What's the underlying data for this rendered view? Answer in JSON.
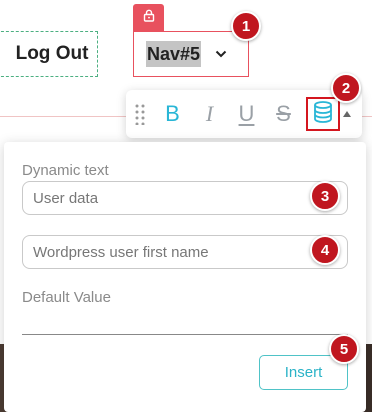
{
  "header": {
    "logout_label": "Log Out",
    "nav_label": "Nav#5"
  },
  "toolbar": {
    "bold": "B",
    "italic": "I",
    "underline": "U",
    "strike": "S"
  },
  "panel": {
    "dynamic_text_label": "Dynamic text",
    "dynamic_text_value": "User data",
    "source_value": "Wordpress user first name",
    "default_value_label": "Default Value",
    "default_value": "",
    "insert_label": "Insert"
  },
  "badges": [
    "1",
    "2",
    "3",
    "4",
    "5"
  ],
  "colors": {
    "accent_red": "#e8515e",
    "badge_red": "#c0161f",
    "teal": "#2bb3c7",
    "dashed_green": "#4caf81"
  }
}
